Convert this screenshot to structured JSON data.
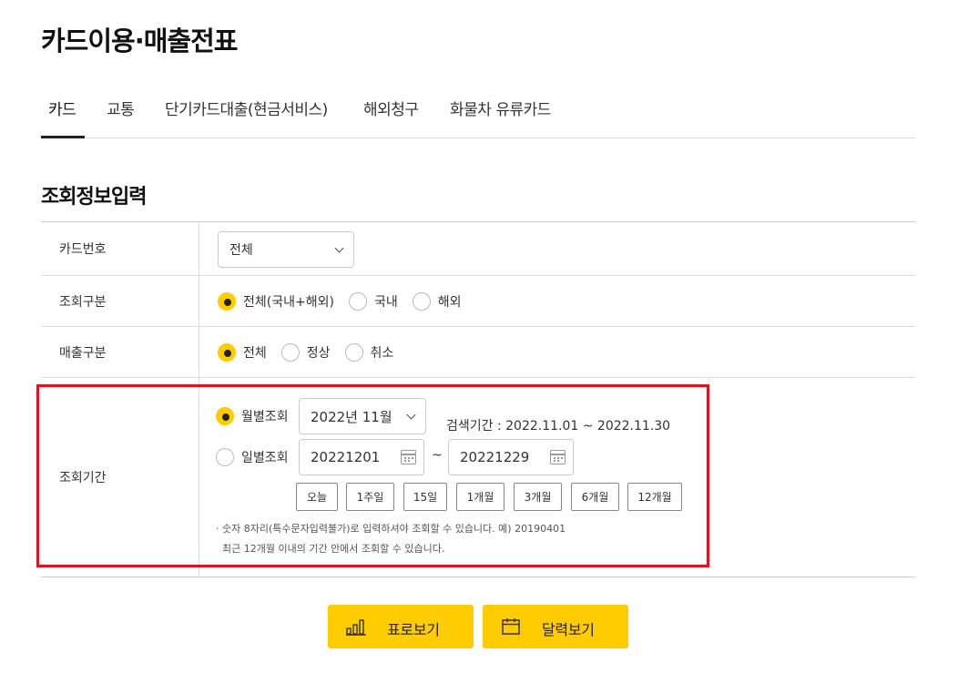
{
  "page_title": "카드이용·매출전표",
  "tabs": [
    {
      "label": "카드"
    },
    {
      "label": "교통"
    },
    {
      "label": "단기카드대출(현금서비스)"
    },
    {
      "label": "해외청구"
    },
    {
      "label": "화물차 유류카드"
    }
  ],
  "section_title": "조회정보입력",
  "form": {
    "card_number": {
      "label": "카드번호",
      "selected": "전체"
    },
    "query_type": {
      "label": "조회구분",
      "options": [
        "전체(국내+해외)",
        "국내",
        "해외"
      ],
      "selected": "전체(국내+해외)"
    },
    "sales_type": {
      "label": "매출구분",
      "options": [
        "전체",
        "정상",
        "취소"
      ],
      "selected": "전체"
    },
    "period": {
      "label": "조회기간",
      "monthly_label": "월별조회",
      "monthly_value": "2022년 11월",
      "search_period_text": "검색기간 : 2022.11.01 ~ 2022.11.30",
      "daily_label": "일별조회",
      "start_date": "20221201",
      "tilde": "~",
      "end_date": "20221229",
      "quick_buttons": [
        "오늘",
        "1주일",
        "15일",
        "1개월",
        "3개월",
        "6개월",
        "12개월"
      ],
      "notice_1": "· 숫자 8자리(특수문자입력불가)로 입력하셔야 조회할 수 있습니다. 예) 20190401",
      "notice_2": "최근 12개월 이내의 기간 안에서 조회할 수 있습니다."
    }
  },
  "buttons": {
    "table_view": "표로보기",
    "calendar_view": "달력보기"
  },
  "colors": {
    "accent": "#ffcc00",
    "highlight": "#e8101c"
  }
}
